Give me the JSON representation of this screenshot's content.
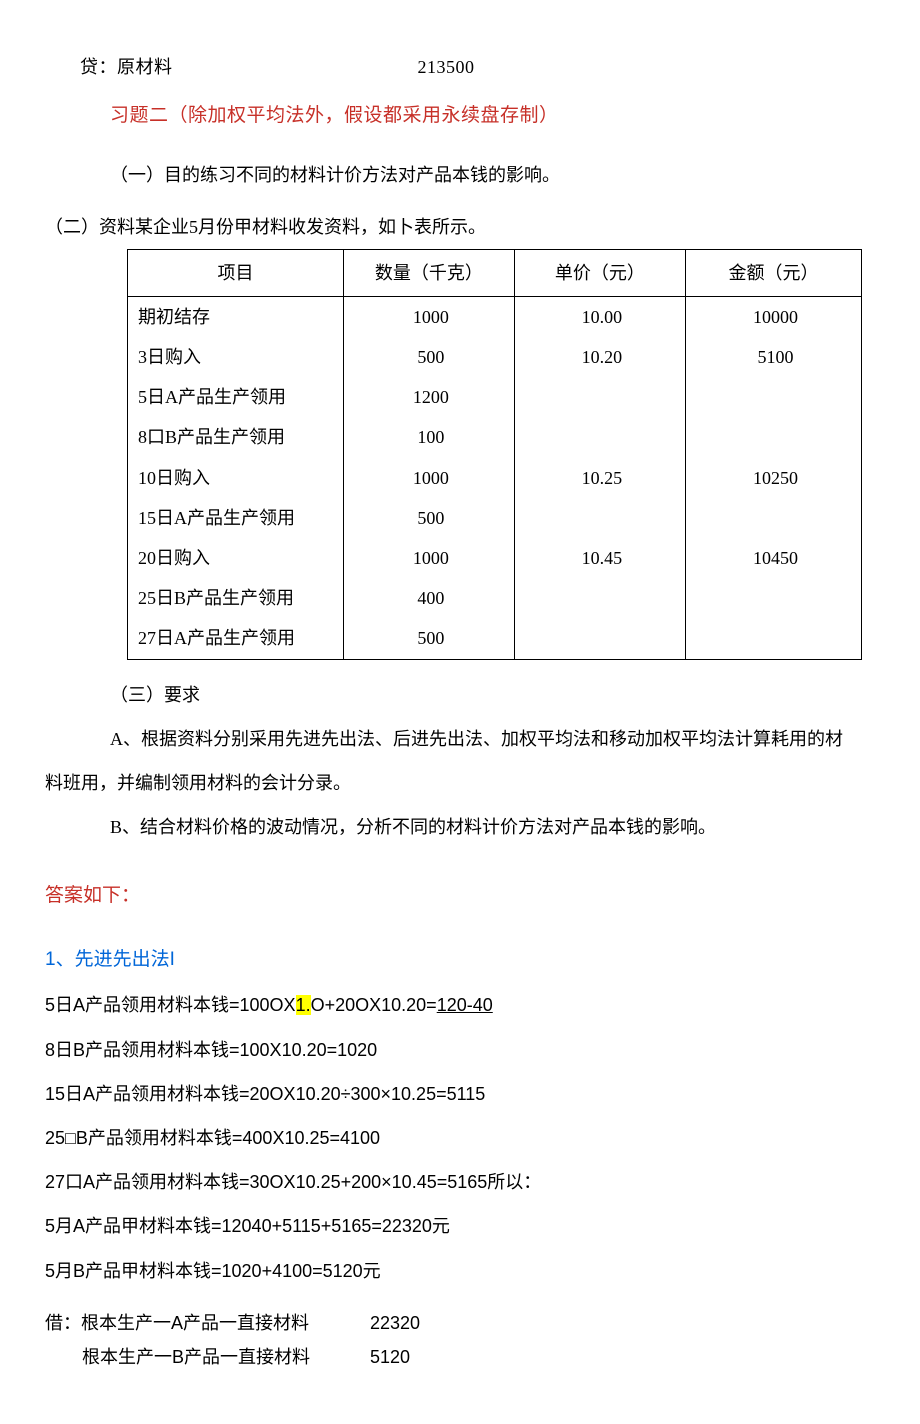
{
  "header": {
    "loan_label": "贷：原材料",
    "loan_amount": "213500"
  },
  "exercise_title": "习题二（除加权平均法外，假设都采用永续盘存制）",
  "purpose_line": "（一）目的练习不同的材料计价方法对产品本钱的影响。",
  "data_intro": "（二）资料某企业5月份甲材料收发资料，如卜表所示。",
  "table": {
    "headers": {
      "item": "项目",
      "qty": "数量（千克）",
      "price": "单价（元）",
      "amount": "金额（元）"
    },
    "rows": [
      {
        "item": "期初结存",
        "qty": "1000",
        "price": "10.00",
        "amount": "10000"
      },
      {
        "item": "3日购入",
        "qty": "500",
        "price": "10.20",
        "amount": "5100"
      },
      {
        "item": "5日A产品生产领用",
        "qty": "1200",
        "price": "",
        "amount": ""
      },
      {
        "item": "8口B产品生产领用",
        "qty": "100",
        "price": "",
        "amount": ""
      },
      {
        "item": "10日购入",
        "qty": "1000",
        "price": "10.25",
        "amount": "10250"
      },
      {
        "item": "15日A产品生产领用",
        "qty": "500",
        "price": "",
        "amount": ""
      },
      {
        "item": "20日购入",
        "qty": "1000",
        "price": "10.45",
        "amount": "10450"
      },
      {
        "item": "25日B产品生产领用",
        "qty": "400",
        "price": "",
        "amount": ""
      },
      {
        "item": "27日A产品生产领用",
        "qty": "500",
        "price": "",
        "amount": ""
      }
    ]
  },
  "requirement_label": "（三）要求",
  "req_a_1": "A、根据资料分别采用先进先出法、后进先出法、加权平均法和移动加权平均法计算耗用的材",
  "req_a_2": "料班用，并编制领用材料的会计分录。",
  "req_b": "B、结合材料价格的波动情况，分析不同的材料计价方法对产品本钱的影响。",
  "answer_title": "答案如下：",
  "method_1": {
    "title": "1、先进先出法I",
    "line1_pre": "5日A产品领用材料本钱=100OX",
    "line1_hl": "1.",
    "line1_mid": "O+20OX10.20=",
    "line1_res": "120-40",
    "line2": "8日B产品领用材料本钱=100X10.20=1020",
    "line3": "15日A产品领用材料本钱=20OX10.20÷300×10.25=5115",
    "line4": "25□B产品领用材料本钱=400X10.25=4100",
    "line5": "27口A产品领用材料本钱=30OX10.25+200×10.45=5165所以：",
    "line6": "5月A产品甲材料本钱=12040+5115+5165=22320元",
    "line7": "5月B产品甲材料本钱=1020+4100=5120元"
  },
  "entries": {
    "debit_label": "借：",
    "line1_text": "根本生产一A产品一直接材料",
    "line1_amt": "22320",
    "line2_text": "根本生产一B产品一直接材料",
    "line2_amt": "5120"
  }
}
